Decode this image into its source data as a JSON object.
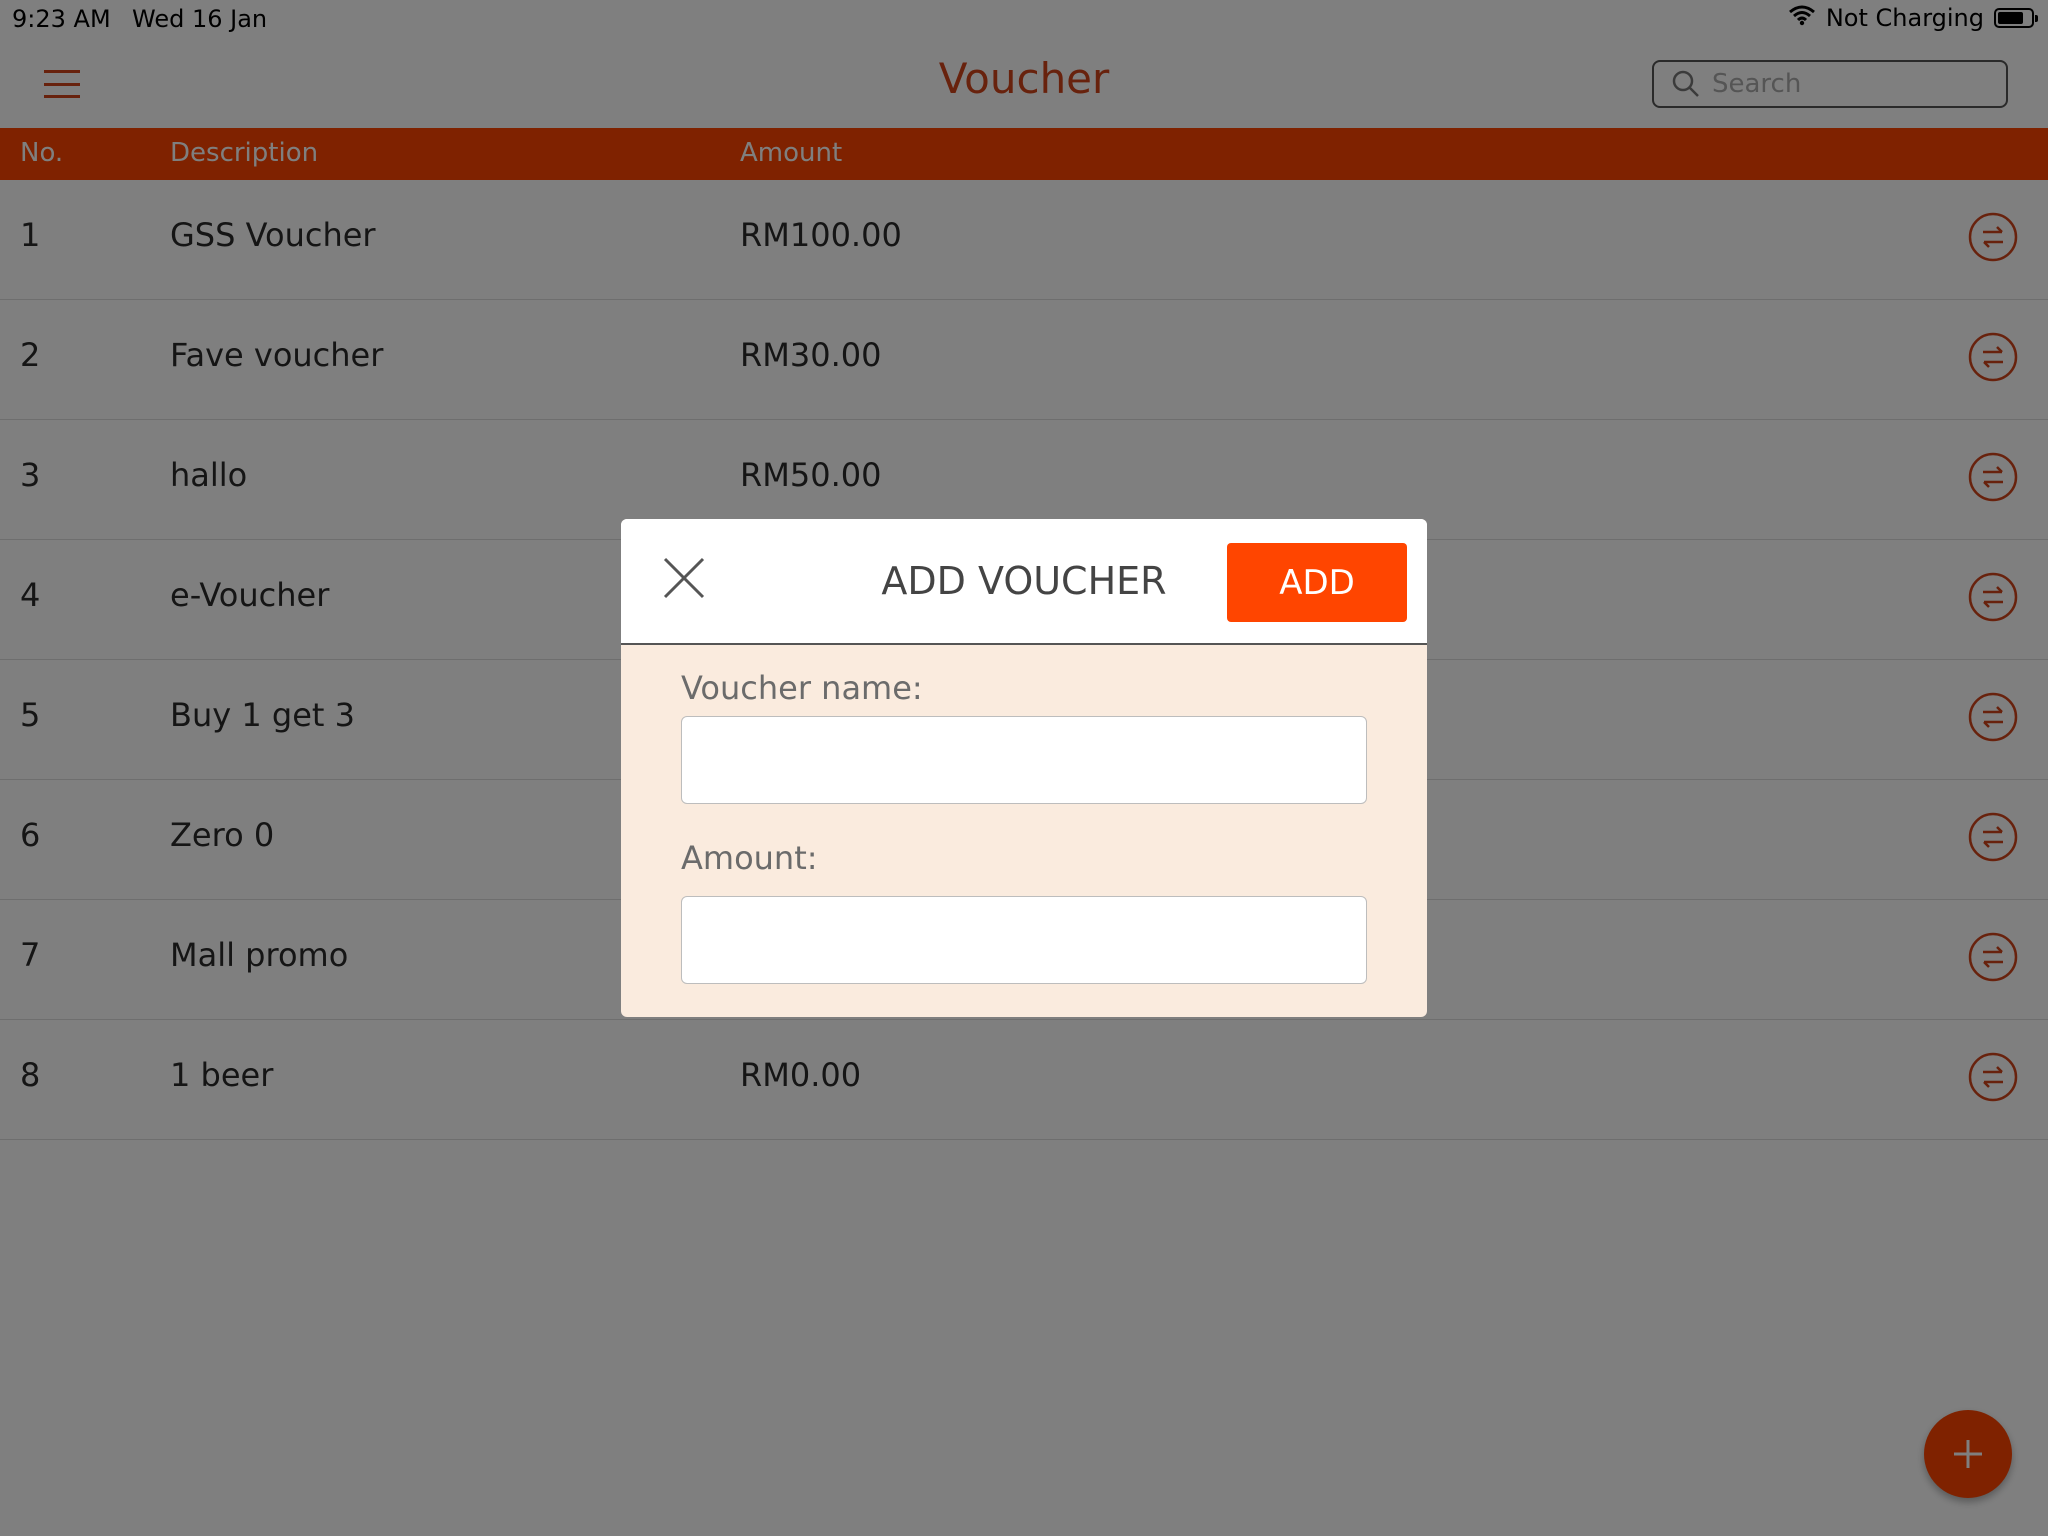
{
  "status_bar": {
    "time": "9:23 AM",
    "date": "Wed 16 Jan",
    "charging": "Not Charging"
  },
  "header": {
    "title": "Voucher",
    "search_placeholder": "Search"
  },
  "table": {
    "columns": [
      "No.",
      "Description",
      "Amount"
    ],
    "rows": [
      {
        "no": "1",
        "description": "GSS Voucher",
        "amount": "RM100.00"
      },
      {
        "no": "2",
        "description": "Fave voucher",
        "amount": "RM30.00"
      },
      {
        "no": "3",
        "description": "hallo",
        "amount": "RM50.00"
      },
      {
        "no": "4",
        "description": "e-Voucher",
        "amount": ""
      },
      {
        "no": "5",
        "description": "Buy 1 get 3",
        "amount": ""
      },
      {
        "no": "6",
        "description": "Zero 0",
        "amount": ""
      },
      {
        "no": "7",
        "description": "Mall promo",
        "amount": ""
      },
      {
        "no": "8",
        "description": "1 beer",
        "amount": "RM0.00"
      }
    ]
  },
  "modal": {
    "title": "ADD VOUCHER",
    "add_label": "ADD",
    "voucher_name_label": "Voucher name:",
    "voucher_name_value": "",
    "amount_label": "Amount:",
    "amount_value": ""
  },
  "colors": {
    "accent": "#ff4500",
    "title": "#d0451b",
    "modal_body": "#faebde"
  },
  "icons": {
    "menu": "hamburger-icon",
    "search": "search-icon",
    "row_action": "transfer-icon",
    "fab": "plus-icon",
    "close": "close-icon"
  }
}
